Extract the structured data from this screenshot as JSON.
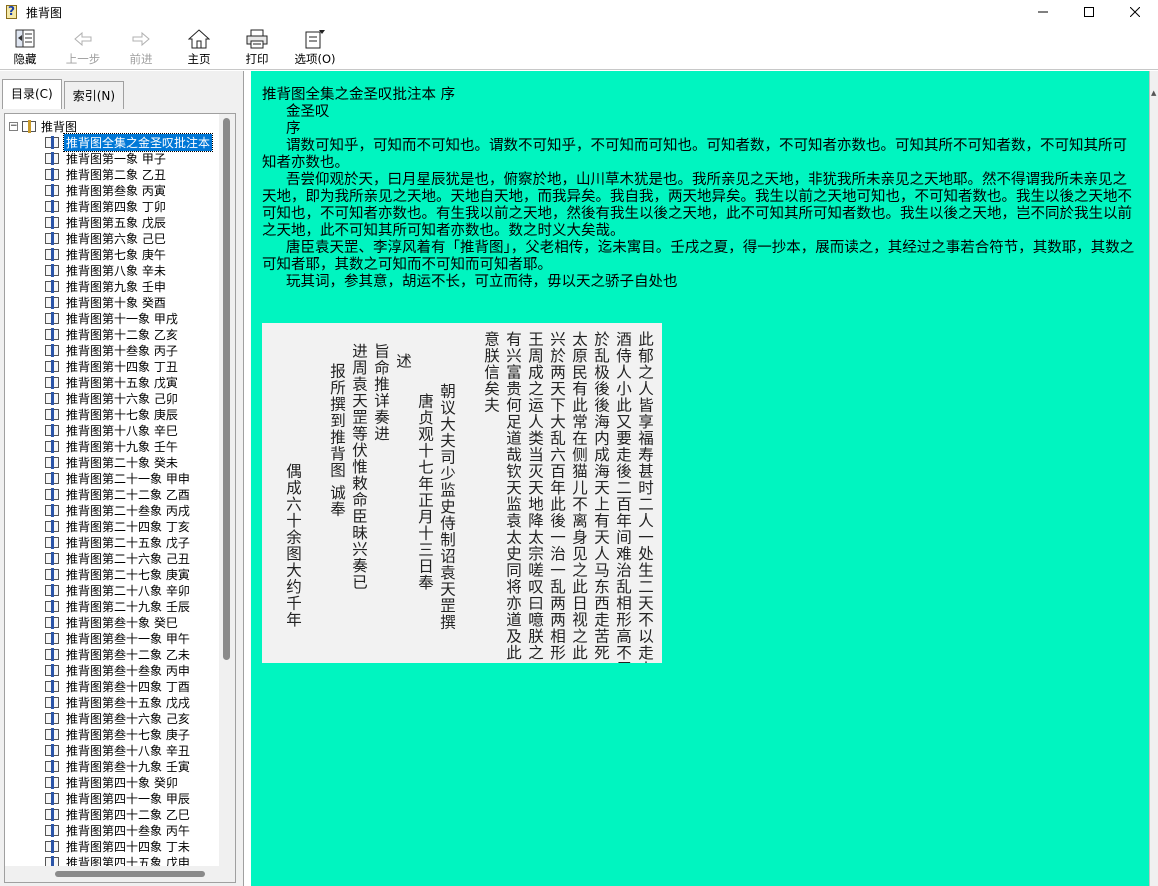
{
  "window": {
    "title": "推背图",
    "controls": [
      "minimize",
      "maximize",
      "close"
    ]
  },
  "toolbar": [
    {
      "label": "隐藏",
      "icon": "hide-icon",
      "enabled": true
    },
    {
      "label": "上一步",
      "icon": "back-arrow-icon",
      "enabled": false
    },
    {
      "label": "前进",
      "icon": "forward-arrow-icon",
      "enabled": false
    },
    {
      "label": "主页",
      "icon": "home-icon",
      "enabled": true
    },
    {
      "label": "打印",
      "icon": "printer-icon",
      "enabled": true
    },
    {
      "label": "选项(O)",
      "icon": "options-icon",
      "enabled": true
    }
  ],
  "tabs": {
    "contents": "目录(C)",
    "index": "索引(N)"
  },
  "tree": {
    "root": "推背图",
    "selected_index": 0,
    "items": [
      "推背图全集之金圣叹批注本",
      "推背图第一象 甲子",
      "推背图第二象 乙丑",
      "推背图第叁象 丙寅",
      "推背图第四象 丁卯",
      "推背图第五象 戊辰",
      "推背图第六象 己巳",
      "推背图第七象 庚午",
      "推背图第八象 辛未",
      "推背图第九象 壬申",
      "推背图第十象 癸酉",
      "推背图第十一象 甲戌",
      "推背图第十二象 乙亥",
      "推背图第十叁象 丙子",
      "推背图第十四象 丁丑",
      "推背图第十五象 戊寅",
      "推背图第十六象 己卯",
      "推背图第十七象 庚辰",
      "推背图第十八象 辛巳",
      "推背图第十九象 壬午",
      "推背图第二十象 癸未",
      "推背图第二十一象 甲申",
      "推背图第二十二象 乙酉",
      "推背图第二十叁象 丙戌",
      "推背图第二十四象 丁亥",
      "推背图第二十五象 戊子",
      "推背图第二十六象 己丑",
      "推背图第二十七象 庚寅",
      "推背图第二十八象 辛卯",
      "推背图第二十九象 壬辰",
      "推背图第叁十象 癸巳",
      "推背图第叁十一象 甲午",
      "推背图第叁十二象 乙未",
      "推背图第叁十叁象 丙申",
      "推背图第叁十四象 丁酉",
      "推背图第叁十五象 戊戌",
      "推背图第叁十六象 己亥",
      "推背图第叁十七象 庚子",
      "推背图第叁十八象 辛丑",
      "推背图第叁十九象 壬寅",
      "推背图第四十象 癸卯",
      "推背图第四十一象 甲辰",
      "推背图第四十二象 乙巳",
      "推背图第四十叁象 丙午",
      "推背图第四十四象 丁未",
      "推背图第四十五象 戊申"
    ]
  },
  "content": {
    "heading": "推背图全集之金圣叹批注本 序",
    "author": "金圣叹",
    "preface": "序",
    "paragraphs": [
      "谓数可知乎，可知而不可知也。谓数不可知乎，不可知而可知也。可知者数，不可知者亦数也。可知其所不可知者数，不可知其所可知者亦数也。",
      "吾尝仰观於天，曰月星辰犹是也，俯察於地，山川草木犹是也。我所亲见之天地，非犹我所未亲见之天地耶。然不得谓我所未亲见之天地，即为我所亲见之天地。天地自天地，而我异矣。我自我，两天地异矣。我生以前之天地可知也，不可知者数也。我生以後之天地不可知也，不可知者亦数也。有生我以前之天地，然後有我生以後之天地，此不可知其所可知者数也。我生以後之天地，岂不同於我生以前之天地，此不可知其所可知者亦数也。数之时义大矣哉。",
      "唐臣袁天罡、李淳风着有「推背图」，父老相传，迄未寓目。壬戌之夏，得一抄本，展而读之，其经过之事若合符节，其数耶，其数之可知者耶，其数之可知而不可知而可知者耶。",
      "玩其词，参其意，胡运不长，可立而待，毋以天之骄子自处也"
    ],
    "manuscript_columns": [
      "此郁之人皆享福寿甚时二人一处生二天不以走大此",
      "酒侍人小此又要走後二百年间难治乱相形高不犀",
      "於乱极後後海内成海天上有天人马东西走苦死",
      "太原民有此常在侧猫儿不离身见之此日视之此",
      "兴於两天下大乱六百年此後一治一乱两两相形",
      "王周成之运人类当灭天地降太宗嗟叹曰噫朕之",
      "有兴富贵何足道哉钦天监袁太史同将亦道及此",
      "意朕信矣夫",
      "",
      "朝议大夫司少监史侍制诏袁天罡撰",
      "唐贞观十七年正月十三日奉",
      "述",
      "旨命推详奏进",
      "进周袁天罡等伏惟敕命臣昧兴奏已",
      "报所撰到推背图  诚奉",
      "",
      "偶成六十余图大约千年"
    ]
  }
}
